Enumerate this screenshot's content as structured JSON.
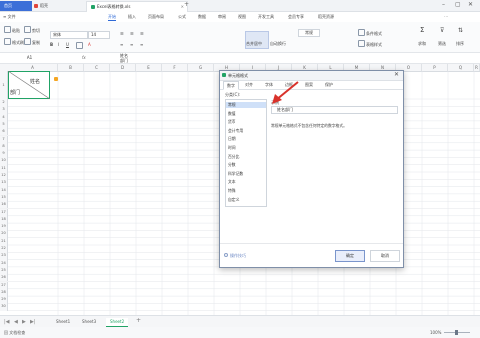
{
  "titlebar": {
    "tabs": [
      {
        "label": "首页"
      },
      {
        "label": "稻壳"
      },
      {
        "label": "Excel表格转换.xls"
      }
    ],
    "new_tab": "+"
  },
  "menu": {
    "file": "≡ 文件",
    "items": [
      "开始",
      "插入",
      "页面布局",
      "公式",
      "数据",
      "审阅",
      "视图",
      "开发工具",
      "会员专享",
      "稻壳资源"
    ],
    "active_index": 0
  },
  "toolbar": {
    "paste": "粘贴",
    "cut": "剪切",
    "copy": "复制",
    "format_painter": "格式刷",
    "font": "宋体",
    "font_size": "14",
    "merge": "合并居中",
    "wrap": "自动换行",
    "number_format": "常规",
    "conditional_format": "条件格式",
    "table_style": "表格样式",
    "sum": "求和",
    "filter": "筛选",
    "sort": "排序",
    "fill": "填充"
  },
  "formula_bar": {
    "name_box": "A1",
    "fx": "fx",
    "content_line1": "姓名",
    "content_line2": "部门"
  },
  "columns": [
    "A",
    "B",
    "C",
    "D",
    "E",
    "F",
    "G",
    "H",
    "I",
    "J",
    "K",
    "L",
    "M",
    "N",
    "O",
    "P",
    "Q",
    "R",
    "S"
  ],
  "rows": [
    "1",
    "2",
    "3",
    "4",
    "5",
    "6",
    "7",
    "8",
    "9",
    "10",
    "11",
    "12",
    "13",
    "14",
    "15",
    "16",
    "17",
    "18",
    "19",
    "20",
    "21",
    "22",
    "23",
    "24",
    "25",
    "26",
    "27",
    "28",
    "29",
    "30",
    "31"
  ],
  "cell_a1": {
    "line1": "姓名",
    "line2": "部门"
  },
  "dialog": {
    "title": "单元格格式",
    "close": "✕",
    "tabs": [
      "数字",
      "对齐",
      "字体",
      "边框",
      "图案",
      "保护"
    ],
    "active_tab": 0,
    "category_label": "分类(C):",
    "categories": [
      "常规",
      "数值",
      "货币",
      "会计专用",
      "日期",
      "时间",
      "百分比",
      "分数",
      "科学记数",
      "文本",
      "特殊",
      "自定义"
    ],
    "selected_category": 0,
    "sample_label": "示例",
    "sample_value": "姓名部门",
    "description": "常规单元格格式不包含任何特定的数字格式。",
    "tips": "操作技巧",
    "ok": "确定",
    "cancel": "取消"
  },
  "sheets": {
    "nav": [
      "|◀",
      "◀",
      "▶",
      "▶|"
    ],
    "tabs": [
      "Sheet1",
      "Sheet3",
      "Sheet2"
    ],
    "active_index": 2,
    "add": "+"
  },
  "statusbar": {
    "left": "回 文档检查",
    "zoom": "100%"
  },
  "colors": {
    "accent": "#2e69d6",
    "cell_border": "#21a366",
    "arrow": "#d9322b"
  }
}
